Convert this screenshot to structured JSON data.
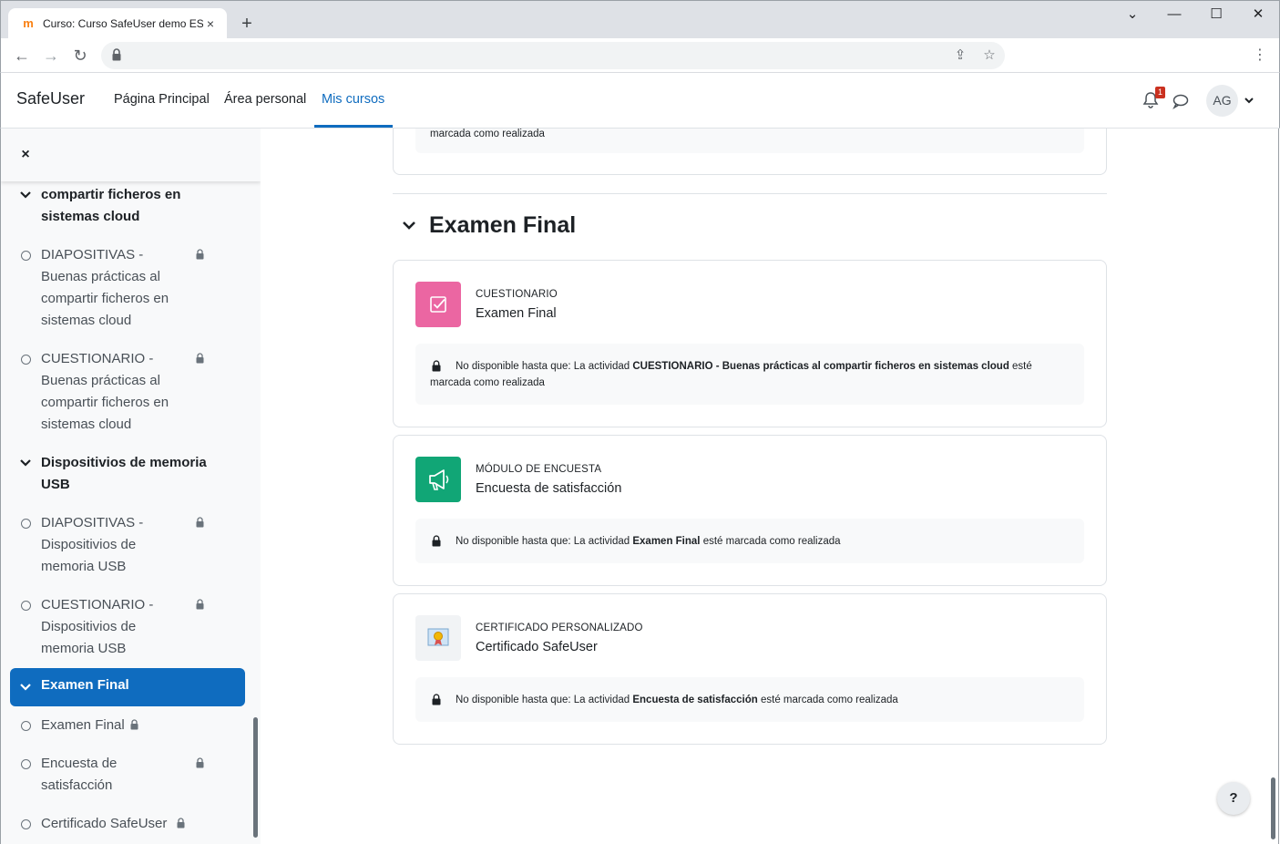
{
  "browser": {
    "tab_title": "Curso: Curso SafeUser demo ES",
    "tab_favicon": "m",
    "tab_close": "×",
    "new_tab": "+",
    "window_controls": {
      "minimize": "⌄",
      "restore": "—",
      "maximize": "☐",
      "close": "✕"
    },
    "nav": {
      "back": "←",
      "forward": "→",
      "reload": "↻"
    },
    "url": "",
    "kebab": "⋮",
    "share": "⇪",
    "star": "☆"
  },
  "navbar": {
    "brand": "SafeUser",
    "links": [
      "Página Principal",
      "Área personal",
      "Mis cursos"
    ],
    "active_link": "Mis cursos",
    "notification_count": "1",
    "user_initials": "AG"
  },
  "drawer": {
    "close": "×",
    "sections": [
      {
        "title": "compartir ficheros en sistemas cloud"
      },
      {
        "title": "Dispositivios de memoria USB"
      }
    ],
    "activities": [
      {
        "label": "DIAPOSITIVAS - Buenas prácticas al compartir ficheros en sistemas cloud"
      },
      {
        "label": "CUESTIONARIO - Buenas prácticas al compartir ficheros en sistemas cloud"
      },
      {
        "label": "DIAPOSITIVAS - Dispositivios de memoria USB"
      },
      {
        "label": "CUESTIONARIO - Dispositivios de memoria USB"
      },
      {
        "label": "Examen Final"
      },
      {
        "label": "Encuesta de satisfacción"
      },
      {
        "label": "Certificado SafeUser"
      }
    ],
    "active_section": "Examen Final"
  },
  "main": {
    "prev_restriction_tail": "marcada como realizada",
    "section_title": "Examen Final",
    "activities": [
      {
        "type": "CUESTIONARIO",
        "name": "Examen Final",
        "restriction_prefix": "No disponible hasta que: La actividad ",
        "restriction_bold": "CUESTIONARIO - Buenas prácticas al compartir ficheros en sistemas cloud",
        "restriction_suffix": " esté marcada como realizada"
      },
      {
        "type": "MÓDULO DE ENCUESTA",
        "name": "Encuesta de satisfacción",
        "restriction_prefix": "No disponible hasta que: La actividad ",
        "restriction_bold": "Examen Final",
        "restriction_suffix": " esté marcada como realizada"
      },
      {
        "type": "CERTIFICADO PERSONALIZADO",
        "name": "Certificado SafeUser",
        "restriction_prefix": "No disponible hasta que: La actividad ",
        "restriction_bold": "Encuesta de satisfacción",
        "restriction_suffix": " esté marcada como realizada"
      }
    ],
    "help": "?"
  },
  "colors": {
    "primary": "#0f6cbf",
    "quiz_icon": "#eb66a2",
    "feedback_icon": "#11a676",
    "badge": "#ca3120"
  }
}
